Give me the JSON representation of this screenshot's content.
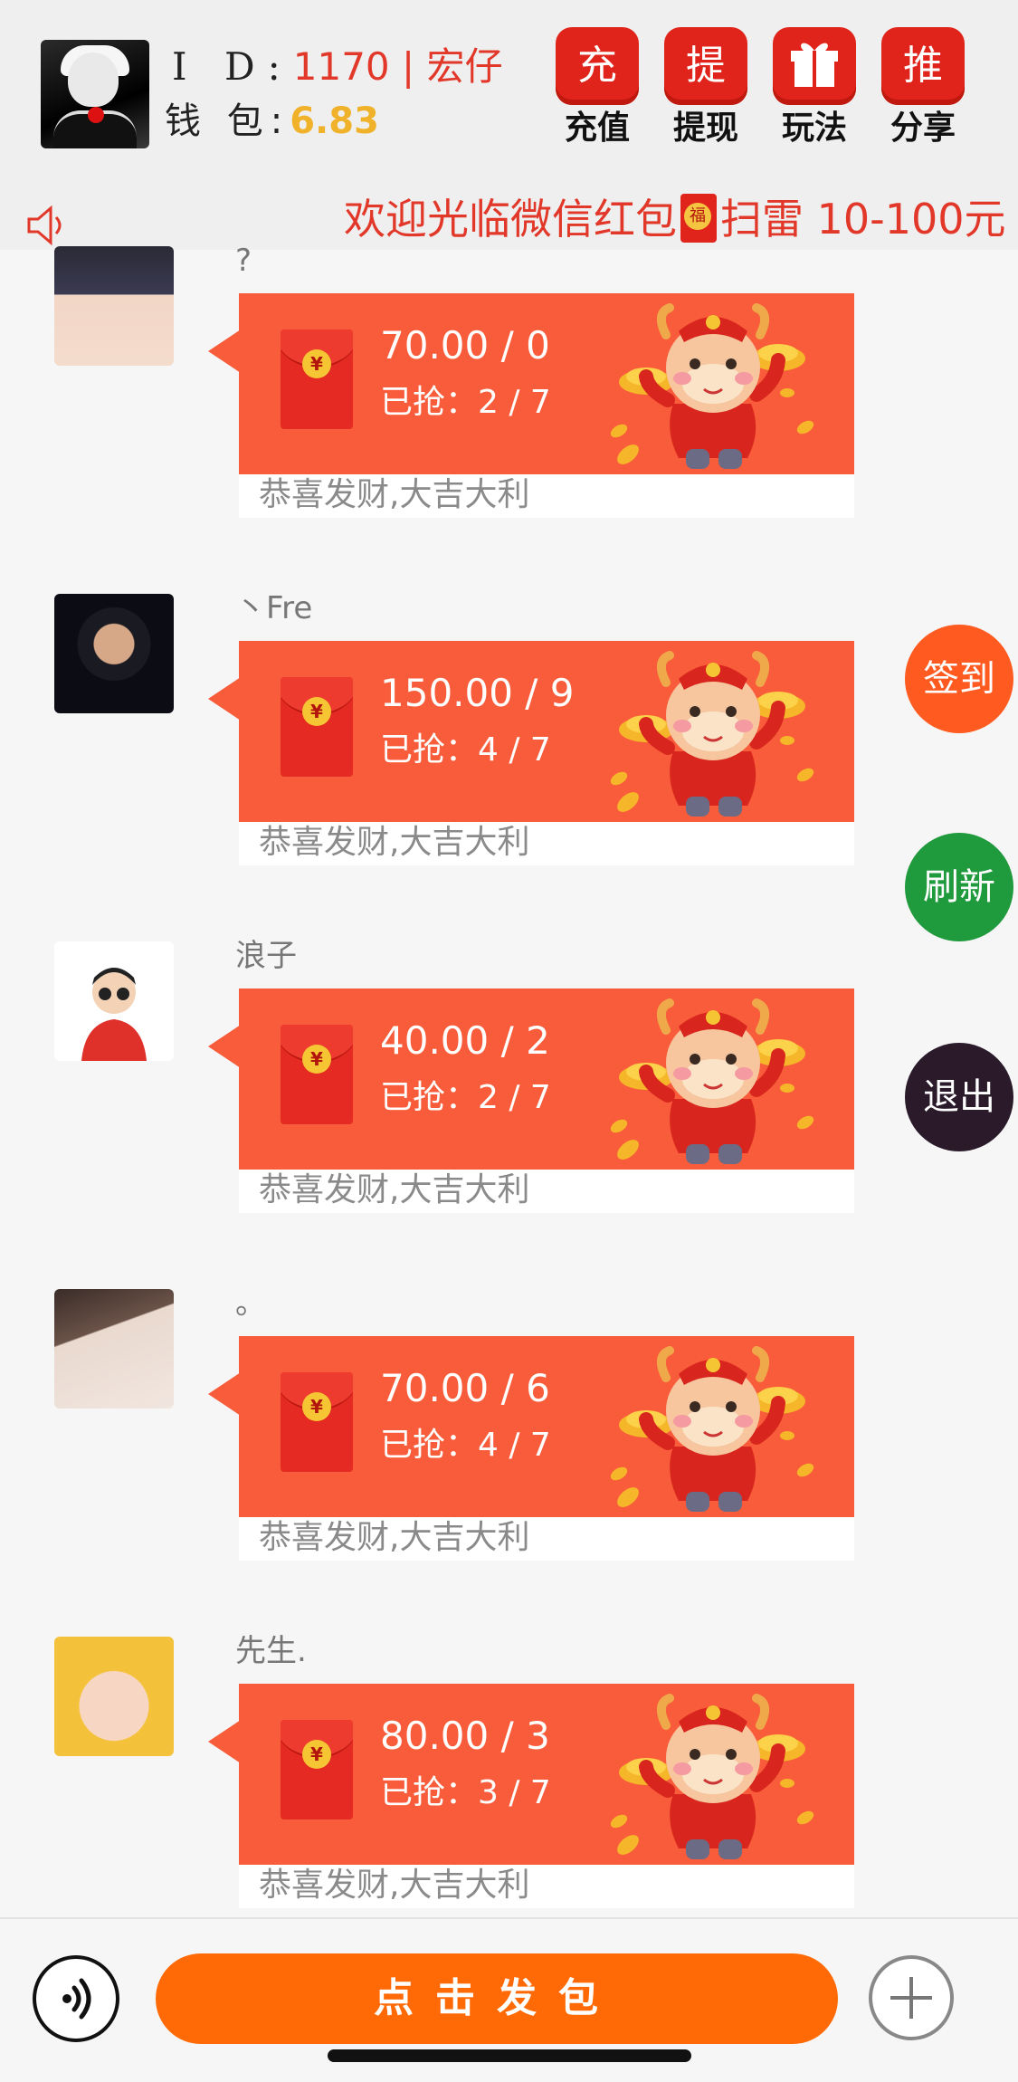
{
  "header": {
    "id_label": "I D:",
    "id_value": "1170 | 宏仔",
    "wallet_label": "钱 包:",
    "wallet_value": "6.83",
    "buttons": [
      {
        "icon_char": "充",
        "label": "充值"
      },
      {
        "icon_char": "提",
        "label": "提现"
      },
      {
        "icon": "gift-icon",
        "label": "玩法"
      },
      {
        "icon_char": "推",
        "label": "分享"
      }
    ]
  },
  "marquee": {
    "text_before": "欢迎光临微信红包",
    "text_after": "扫雷 10-100元"
  },
  "messages": [
    {
      "name": "?",
      "amount": "70.00 / 0",
      "grabbed": "已抢：2 / 7",
      "blessing": "恭喜发财,大吉大利"
    },
    {
      "name": "丶Fre",
      "amount": "150.00 / 9",
      "grabbed": "已抢：4 / 7",
      "blessing": "恭喜发财,大吉大利"
    },
    {
      "name": "浪子",
      "amount": "40.00 / 2",
      "grabbed": "已抢：2 / 7",
      "blessing": "恭喜发财,大吉大利"
    },
    {
      "name": "。",
      "amount": "70.00 / 6",
      "grabbed": "已抢：4 / 7",
      "blessing": "恭喜发财,大吉大利"
    },
    {
      "name": "先生.",
      "amount": "80.00 / 3",
      "grabbed": "已抢：3 / 7",
      "blessing": "恭喜发财,大吉大利"
    }
  ],
  "side_buttons": {
    "checkin": {
      "label": "签到",
      "color": "#ff5a1f"
    },
    "refresh": {
      "label": "刷新",
      "color": "#1f9a3c"
    },
    "exit": {
      "label": "退出",
      "color": "#2a1a2a"
    }
  },
  "bottom": {
    "send_label": "点击发包"
  },
  "colors": {
    "accent_red": "#e2382a",
    "bubble": "#f85c3a",
    "send": "#ff6a06",
    "wallet": "#f0b22a"
  }
}
